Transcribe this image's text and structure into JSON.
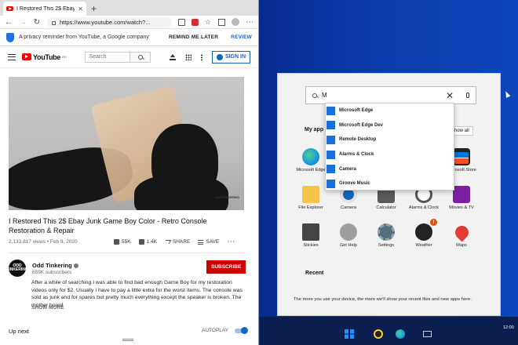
{
  "browser": {
    "tab_title": "I Restored This 2$ Ebay Junk",
    "url": "https://www.youtube.com/watch?...",
    "reminder": {
      "text": "A privacy reminder from YouTube, a Google company",
      "remind_label": "REMIND ME LATER",
      "review_label": "REVIEW"
    }
  },
  "youtube": {
    "logo_text": "YouTube",
    "logo_region": "RO",
    "search_placeholder": "Search",
    "signin_label": "SIGN IN",
    "video": {
      "overlay_logo": "ODDTINKERING",
      "title": "I Restored This 2$ Ebay Junk Game Boy Color - Retro Console Restoration & Repair",
      "views": "2,133,817 views",
      "date": "Feb 9, 2020",
      "likes": "55K",
      "dislikes": "1.4K",
      "share_label": "SHARE",
      "save_label": "SAVE"
    },
    "channel": {
      "avatar_text": "ODD TINKERING",
      "name": "Odd Tinkering",
      "subscribers": "659K subscribers",
      "subscribe_label": "SUBSCRIBE"
    },
    "description": "After a while of searching I was able to find bad enough Game Boy for my restoration videos only for $2. Usually I have to pay a little extra for the worst items. The console was sold as junk and for spares but pretty much everything except the speaker is broken. The mother board",
    "show_more": "SHOW MORE",
    "up_next": "Up next",
    "autoplay": "AUTOPLAY"
  },
  "start_menu": {
    "search_value": "M",
    "pinned_label": "My app",
    "all_apps_label": "Show all",
    "suggestions": [
      "Microsoft Edge",
      "Microsoft Edge Dev",
      "Remote Desktop",
      "Alarms & Clock",
      "Camera",
      "Groove Music"
    ],
    "apps": [
      {
        "label": "Microsoft Edge",
        "icon": "edge-icon"
      },
      {
        "label": "",
        "icon": ""
      },
      {
        "label": "",
        "icon": ""
      },
      {
        "label": "",
        "icon": ""
      },
      {
        "label": "Microsoft Store",
        "icon": "store-icon"
      },
      {
        "label": "File Explorer",
        "icon": "folder-icon"
      },
      {
        "label": "Camera",
        "icon": "camera-icon"
      },
      {
        "label": "Calculator",
        "icon": "calculator-icon"
      },
      {
        "label": "Alarms & Clock",
        "icon": "alarm-icon"
      },
      {
        "label": "Movies & TV",
        "icon": "movies-icon"
      },
      {
        "label": "Stickies",
        "icon": "stickies-icon"
      },
      {
        "label": "Get Help",
        "icon": "help-icon"
      },
      {
        "label": "Settings",
        "icon": "settings-icon"
      },
      {
        "label": "Weather",
        "icon": "weather-icon"
      },
      {
        "label": "Maps",
        "icon": "maps-icon"
      }
    ],
    "recent_label": "Recent",
    "recent_text": "The more you use your device, the more we'll show your recent files and new apps here."
  },
  "taskbar": {
    "clock": "12:00",
    "weather_badge": "!"
  },
  "colors": {
    "youtube_red": "#ff0000",
    "link_blue": "#1565c0",
    "desktop_blue": "#0a3aa8",
    "taskbar": "#0b1e4f"
  }
}
